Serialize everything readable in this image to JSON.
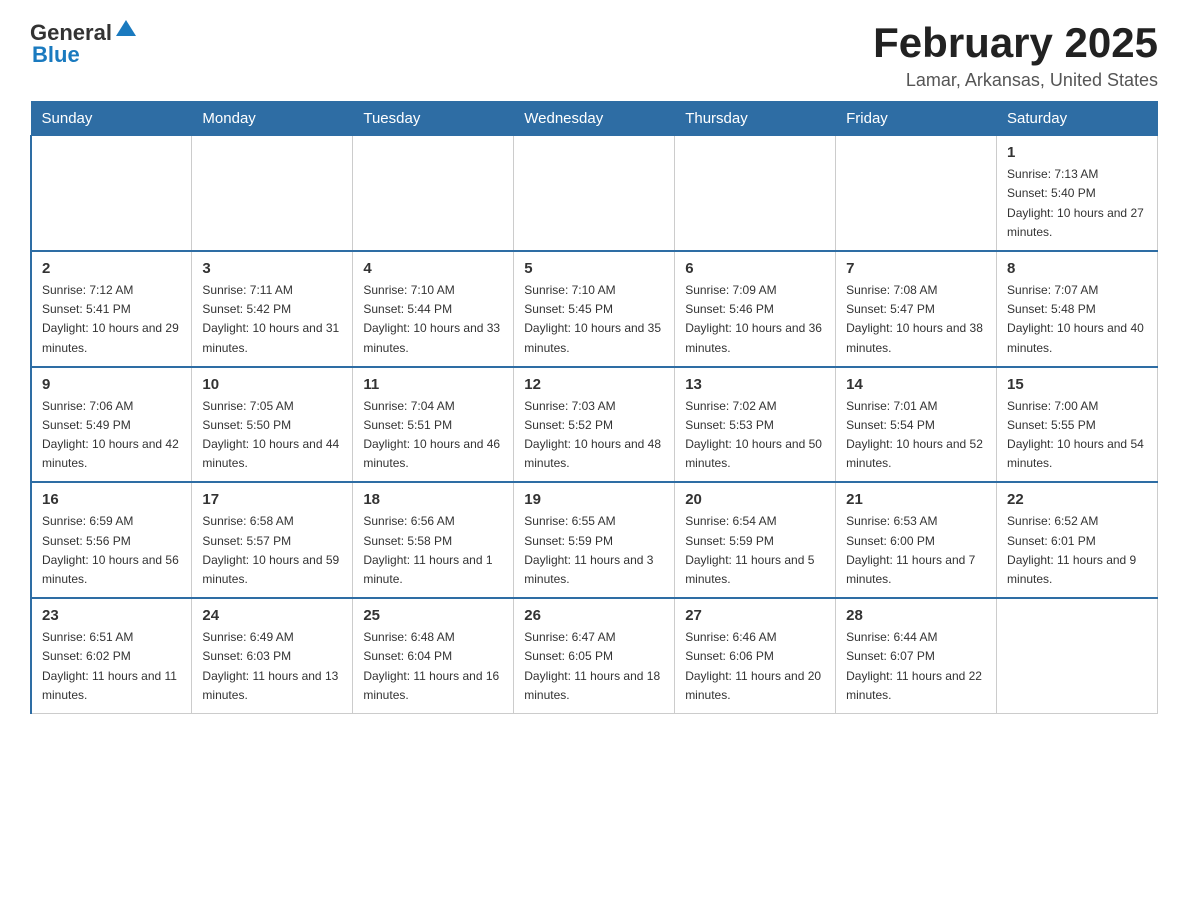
{
  "header": {
    "logo_general": "General",
    "logo_blue": "Blue",
    "title": "February 2025",
    "location": "Lamar, Arkansas, United States"
  },
  "days_of_week": [
    "Sunday",
    "Monday",
    "Tuesday",
    "Wednesday",
    "Thursday",
    "Friday",
    "Saturday"
  ],
  "weeks": [
    [
      {
        "day": "",
        "sunrise": "",
        "sunset": "",
        "daylight": ""
      },
      {
        "day": "",
        "sunrise": "",
        "sunset": "",
        "daylight": ""
      },
      {
        "day": "",
        "sunrise": "",
        "sunset": "",
        "daylight": ""
      },
      {
        "day": "",
        "sunrise": "",
        "sunset": "",
        "daylight": ""
      },
      {
        "day": "",
        "sunrise": "",
        "sunset": "",
        "daylight": ""
      },
      {
        "day": "",
        "sunrise": "",
        "sunset": "",
        "daylight": ""
      },
      {
        "day": "1",
        "sunrise": "Sunrise: 7:13 AM",
        "sunset": "Sunset: 5:40 PM",
        "daylight": "Daylight: 10 hours and 27 minutes."
      }
    ],
    [
      {
        "day": "2",
        "sunrise": "Sunrise: 7:12 AM",
        "sunset": "Sunset: 5:41 PM",
        "daylight": "Daylight: 10 hours and 29 minutes."
      },
      {
        "day": "3",
        "sunrise": "Sunrise: 7:11 AM",
        "sunset": "Sunset: 5:42 PM",
        "daylight": "Daylight: 10 hours and 31 minutes."
      },
      {
        "day": "4",
        "sunrise": "Sunrise: 7:10 AM",
        "sunset": "Sunset: 5:44 PM",
        "daylight": "Daylight: 10 hours and 33 minutes."
      },
      {
        "day": "5",
        "sunrise": "Sunrise: 7:10 AM",
        "sunset": "Sunset: 5:45 PM",
        "daylight": "Daylight: 10 hours and 35 minutes."
      },
      {
        "day": "6",
        "sunrise": "Sunrise: 7:09 AM",
        "sunset": "Sunset: 5:46 PM",
        "daylight": "Daylight: 10 hours and 36 minutes."
      },
      {
        "day": "7",
        "sunrise": "Sunrise: 7:08 AM",
        "sunset": "Sunset: 5:47 PM",
        "daylight": "Daylight: 10 hours and 38 minutes."
      },
      {
        "day": "8",
        "sunrise": "Sunrise: 7:07 AM",
        "sunset": "Sunset: 5:48 PM",
        "daylight": "Daylight: 10 hours and 40 minutes."
      }
    ],
    [
      {
        "day": "9",
        "sunrise": "Sunrise: 7:06 AM",
        "sunset": "Sunset: 5:49 PM",
        "daylight": "Daylight: 10 hours and 42 minutes."
      },
      {
        "day": "10",
        "sunrise": "Sunrise: 7:05 AM",
        "sunset": "Sunset: 5:50 PM",
        "daylight": "Daylight: 10 hours and 44 minutes."
      },
      {
        "day": "11",
        "sunrise": "Sunrise: 7:04 AM",
        "sunset": "Sunset: 5:51 PM",
        "daylight": "Daylight: 10 hours and 46 minutes."
      },
      {
        "day": "12",
        "sunrise": "Sunrise: 7:03 AM",
        "sunset": "Sunset: 5:52 PM",
        "daylight": "Daylight: 10 hours and 48 minutes."
      },
      {
        "day": "13",
        "sunrise": "Sunrise: 7:02 AM",
        "sunset": "Sunset: 5:53 PM",
        "daylight": "Daylight: 10 hours and 50 minutes."
      },
      {
        "day": "14",
        "sunrise": "Sunrise: 7:01 AM",
        "sunset": "Sunset: 5:54 PM",
        "daylight": "Daylight: 10 hours and 52 minutes."
      },
      {
        "day": "15",
        "sunrise": "Sunrise: 7:00 AM",
        "sunset": "Sunset: 5:55 PM",
        "daylight": "Daylight: 10 hours and 54 minutes."
      }
    ],
    [
      {
        "day": "16",
        "sunrise": "Sunrise: 6:59 AM",
        "sunset": "Sunset: 5:56 PM",
        "daylight": "Daylight: 10 hours and 56 minutes."
      },
      {
        "day": "17",
        "sunrise": "Sunrise: 6:58 AM",
        "sunset": "Sunset: 5:57 PM",
        "daylight": "Daylight: 10 hours and 59 minutes."
      },
      {
        "day": "18",
        "sunrise": "Sunrise: 6:56 AM",
        "sunset": "Sunset: 5:58 PM",
        "daylight": "Daylight: 11 hours and 1 minute."
      },
      {
        "day": "19",
        "sunrise": "Sunrise: 6:55 AM",
        "sunset": "Sunset: 5:59 PM",
        "daylight": "Daylight: 11 hours and 3 minutes."
      },
      {
        "day": "20",
        "sunrise": "Sunrise: 6:54 AM",
        "sunset": "Sunset: 5:59 PM",
        "daylight": "Daylight: 11 hours and 5 minutes."
      },
      {
        "day": "21",
        "sunrise": "Sunrise: 6:53 AM",
        "sunset": "Sunset: 6:00 PM",
        "daylight": "Daylight: 11 hours and 7 minutes."
      },
      {
        "day": "22",
        "sunrise": "Sunrise: 6:52 AM",
        "sunset": "Sunset: 6:01 PM",
        "daylight": "Daylight: 11 hours and 9 minutes."
      }
    ],
    [
      {
        "day": "23",
        "sunrise": "Sunrise: 6:51 AM",
        "sunset": "Sunset: 6:02 PM",
        "daylight": "Daylight: 11 hours and 11 minutes."
      },
      {
        "day": "24",
        "sunrise": "Sunrise: 6:49 AM",
        "sunset": "Sunset: 6:03 PM",
        "daylight": "Daylight: 11 hours and 13 minutes."
      },
      {
        "day": "25",
        "sunrise": "Sunrise: 6:48 AM",
        "sunset": "Sunset: 6:04 PM",
        "daylight": "Daylight: 11 hours and 16 minutes."
      },
      {
        "day": "26",
        "sunrise": "Sunrise: 6:47 AM",
        "sunset": "Sunset: 6:05 PM",
        "daylight": "Daylight: 11 hours and 18 minutes."
      },
      {
        "day": "27",
        "sunrise": "Sunrise: 6:46 AM",
        "sunset": "Sunset: 6:06 PM",
        "daylight": "Daylight: 11 hours and 20 minutes."
      },
      {
        "day": "28",
        "sunrise": "Sunrise: 6:44 AM",
        "sunset": "Sunset: 6:07 PM",
        "daylight": "Daylight: 11 hours and 22 minutes."
      },
      {
        "day": "",
        "sunrise": "",
        "sunset": "",
        "daylight": ""
      }
    ]
  ]
}
